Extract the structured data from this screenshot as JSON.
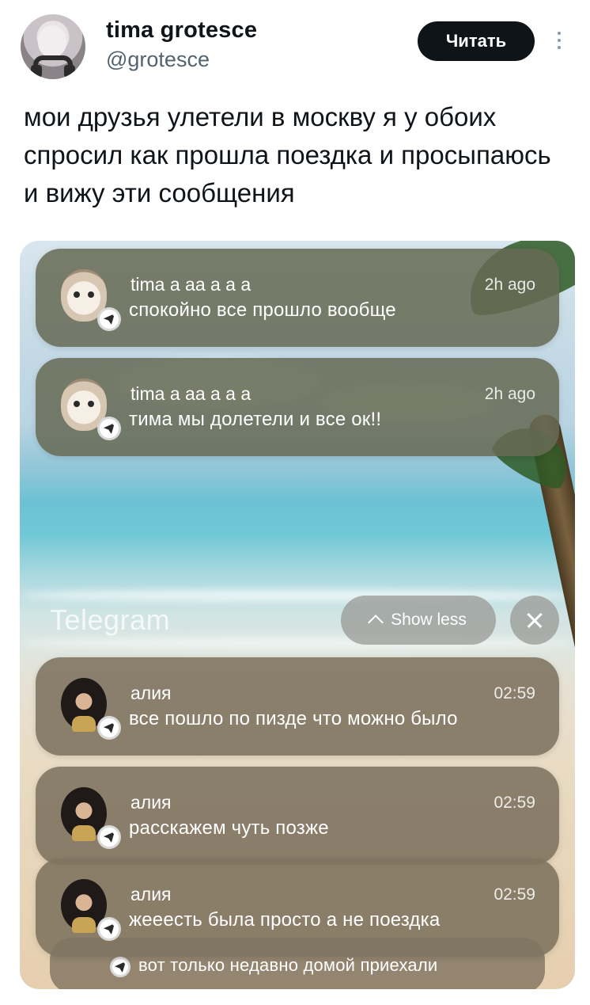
{
  "tweet": {
    "author_name": "tima grotesce",
    "author_handle": "@grotesce",
    "follow_label": "Читать",
    "text": "мои друзья улетели в москву я у обоих спросил как прошла поездка и просыпаюсь и вижу эти сообщения"
  },
  "media": {
    "app_label": "Telegram",
    "show_less_label": "Show less",
    "notifications_top": [
      {
        "sender": "tima a aa a a a",
        "time": "2h ago",
        "message": "спокойно все прошло вообще"
      },
      {
        "sender": "tima a aa a a a",
        "time": "2h ago",
        "message": "тима мы долетели и все ок!!"
      }
    ],
    "notifications_bottom": [
      {
        "sender": "алия",
        "time": "02:59",
        "message": "все пошло по пизде что можно было"
      },
      {
        "sender": "алия",
        "time": "02:59",
        "message": "расскажем чуть позже"
      },
      {
        "sender": "алия",
        "time": "02:59",
        "message": "жееесть была просто а не поездка"
      }
    ],
    "peek_message": "вот только недавно домой приехали"
  }
}
